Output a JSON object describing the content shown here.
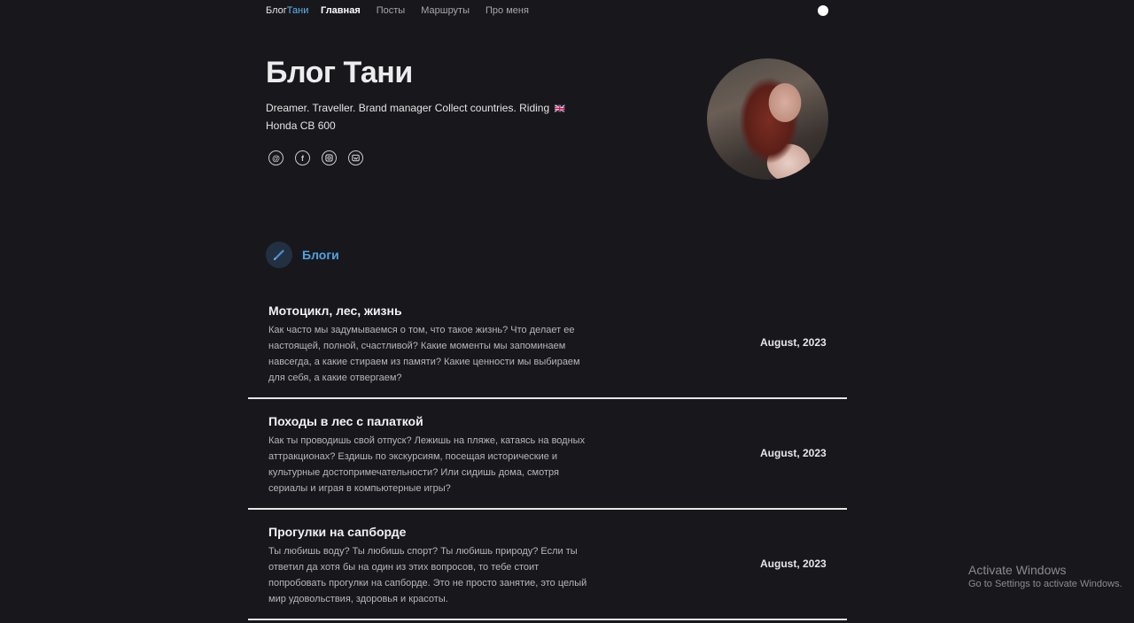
{
  "nav": {
    "brand_prefix": "Блог",
    "brand_accent": "Тани",
    "links": [
      "Главная",
      "Посты",
      "Маршруты",
      "Про меня"
    ]
  },
  "hero": {
    "title": "Блог Тани",
    "bio_line1": "Dreamer. Traveller. Brand manager Collect countries. Riding",
    "bio_flag": "🇬🇧",
    "bio_line2": "Honda CB 600",
    "socials": [
      "at-icon",
      "facebook-icon",
      "instagram-icon",
      "vk-icon"
    ]
  },
  "section": {
    "title": "Блоги"
  },
  "posts": [
    {
      "title": "Мотоцикл, лес, жизнь",
      "excerpt": "Как часто мы задумываемся о том, что такое жизнь? Что делает ее настоящей, полной, счастливой? Какие моменты мы запоминаем навсегда, а какие стираем из памяти? Какие ценности мы выбираем для себя, а какие отвергаем?",
      "date": "August, 2023"
    },
    {
      "title": "Походы в лес с палаткой",
      "excerpt": "Как ты проводишь свой отпуск? Лежишь на пляже, катаясь на водных аттракционах? Ездишь по экскурсиям, посещая исторические и культурные достопримечательности? Или сидишь дома, смотря сериалы и играя в компьютерные игры?",
      "date": "August, 2023"
    },
    {
      "title": "Прогулки на сапборде",
      "excerpt": "Ты любишь воду? Ты любишь спорт? Ты любишь природу? Если ты ответил да хотя бы на один из этих вопросов, то тебе стоит попробовать прогулки на сапборде. Это не просто занятие, это целый мир удовольствия, здоровья и красоты.",
      "date": "August, 2023"
    }
  ],
  "windows": {
    "line1": "Activate Windows",
    "line2": "Go to Settings to activate Windows."
  },
  "colors": {
    "background": "#18181c",
    "accent": "#4fa3e3"
  }
}
